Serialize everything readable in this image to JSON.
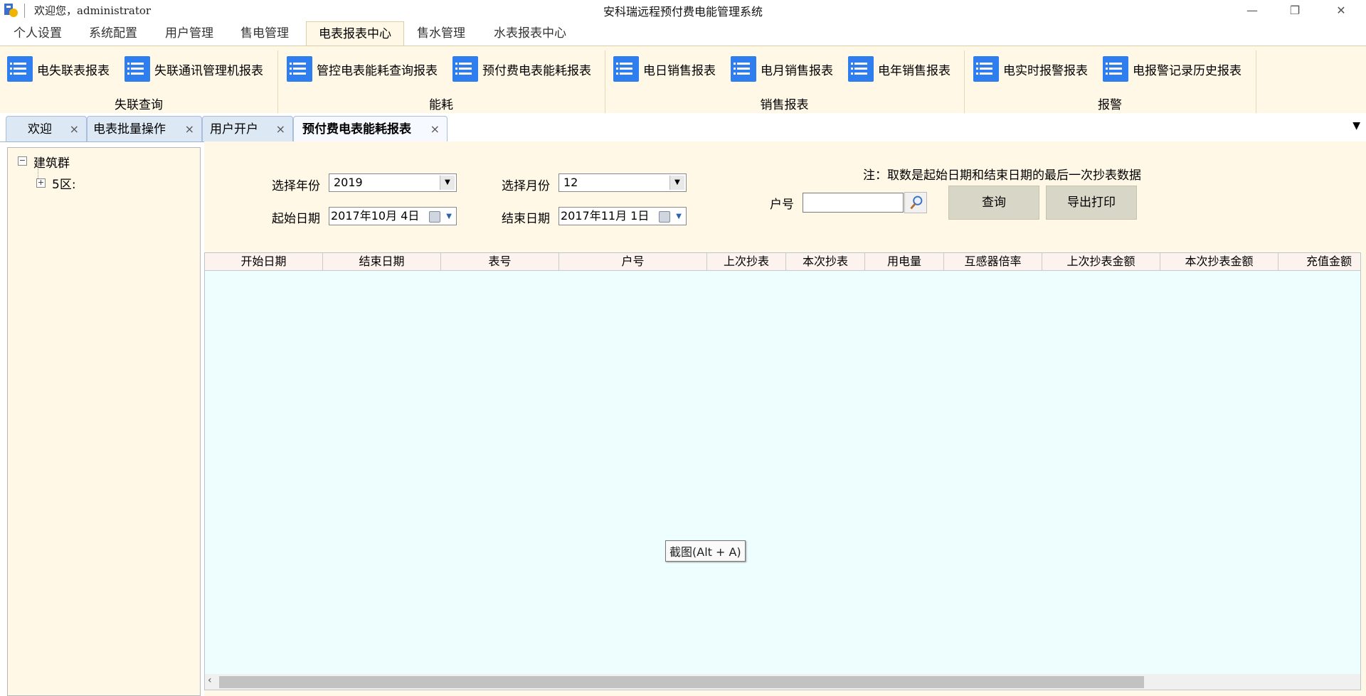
{
  "window": {
    "welcome": "欢迎您，administrator",
    "title": "安科瑞远程预付费电能管理系统",
    "minimize": "—",
    "restore": "❐",
    "close": "✕"
  },
  "menu": {
    "tabs": [
      "个人设置",
      "系统配置",
      "用户管理",
      "售电管理",
      "电表报表中心",
      "售水管理",
      "水表报表中心"
    ],
    "active_index": 4
  },
  "ribbon": {
    "buttons": [
      "电失联表报表",
      "失联通讯管理机报表",
      "管控电表能耗查询报表",
      "预付费电表能耗报表",
      "电日销售报表",
      "电月销售报表",
      "电年销售报表",
      "电实时报警报表",
      "电报警记录历史报表"
    ],
    "groups": [
      "失联查询",
      "能耗",
      "销售报表",
      "报警"
    ]
  },
  "doc_tabs": {
    "tabs": [
      "欢迎",
      "电表批量操作",
      "用户开户",
      "预付费电表能耗报表"
    ],
    "active_index": 3,
    "close_glyph": "×",
    "dropdown_glyph": "▼"
  },
  "tree": {
    "root": "建筑群",
    "child": "5区:",
    "root_expander": "−",
    "child_expander": "+"
  },
  "form": {
    "year_label": "选择年份",
    "year_value": "2019",
    "month_label": "选择月份",
    "month_value": "12",
    "start_label": "起始日期",
    "start_value": "2017年10月  4日",
    "end_label": "结束日期",
    "end_value": "2017年11月  1日",
    "note": "注：取数是起始日期和结束日期的最后一次抄表数据",
    "account_label": "户号",
    "account_value": "",
    "query_button": "查询",
    "export_button": "导出打印"
  },
  "grid": {
    "columns": [
      "开始日期",
      "结束日期",
      "表号",
      "户号",
      "上次抄表",
      "本次抄表",
      "用电量",
      "互感器倍率",
      "上次抄表金额",
      "本次抄表金额",
      "充值金额"
    ],
    "rows": []
  },
  "tooltip": "截图(Alt + A)",
  "colors": {
    "ribbon_bg": "#fff8e6",
    "icon_blue": "#2f7ef0",
    "grid_bg": "#eefeff"
  }
}
